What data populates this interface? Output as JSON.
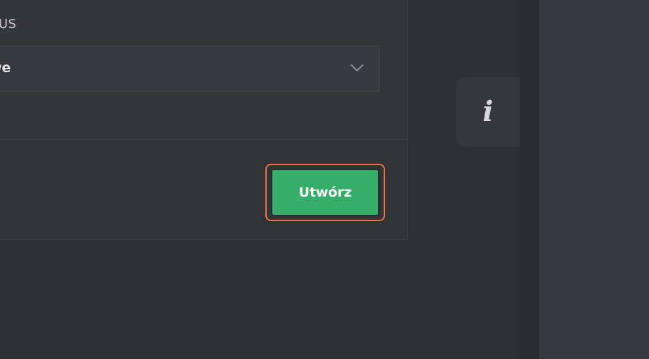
{
  "form": {
    "field_label": "US",
    "select_value": "we"
  },
  "footer": {
    "create_label": "Utwórz"
  },
  "info_tab": {
    "glyph": "i"
  },
  "icons": {
    "select_chevron": "chevron-down-icon",
    "info": "info-icon"
  },
  "colors": {
    "background": "#2f3034",
    "card": "#35363a",
    "primary_button": "#36ad68",
    "focus_ring": "#e8744f"
  }
}
